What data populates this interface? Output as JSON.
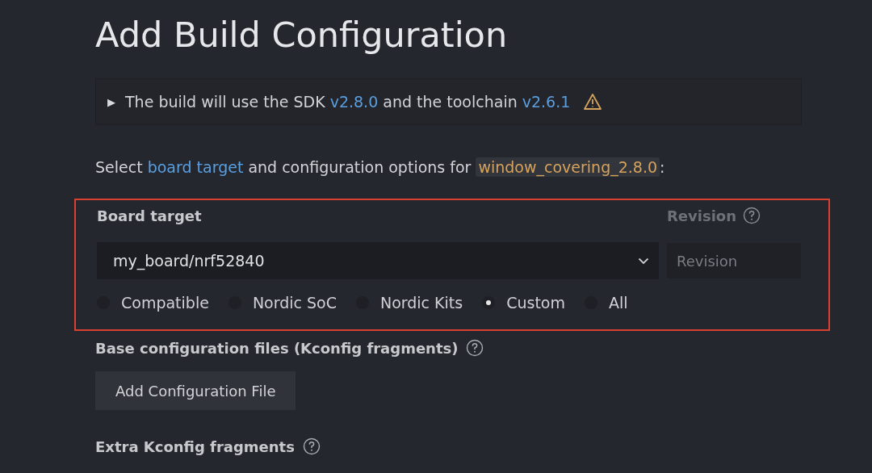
{
  "title": "Add Build Configuration",
  "notice": {
    "expanded": false,
    "toggle": "▶",
    "before": "The build will use the SDK",
    "sdk_version": "v2.8.0",
    "middle": "and the toolchain",
    "toolchain_version": "v2.6.1",
    "warning": true
  },
  "intro": {
    "before": "Select",
    "link": "board target",
    "middle": "and configuration options for",
    "application": "window_covering_2.8.0",
    "after": ":"
  },
  "board_section": {
    "highlighted": true,
    "label": "Board target",
    "revision_label": "Revision",
    "board_value": "my_board/nrf52840",
    "revision_placeholder": "Revision",
    "revision_disabled": true,
    "filters": [
      {
        "label": "Compatible",
        "selected": false
      },
      {
        "label": "Nordic SoC",
        "selected": false
      },
      {
        "label": "Nordic Kits",
        "selected": false
      },
      {
        "label": "Custom",
        "selected": true
      },
      {
        "label": "All",
        "selected": false
      }
    ]
  },
  "base_config": {
    "label": "Base configuration files (Kconfig fragments)",
    "button": "Add Configuration File"
  },
  "extra_config": {
    "label": "Extra Kconfig fragments"
  }
}
